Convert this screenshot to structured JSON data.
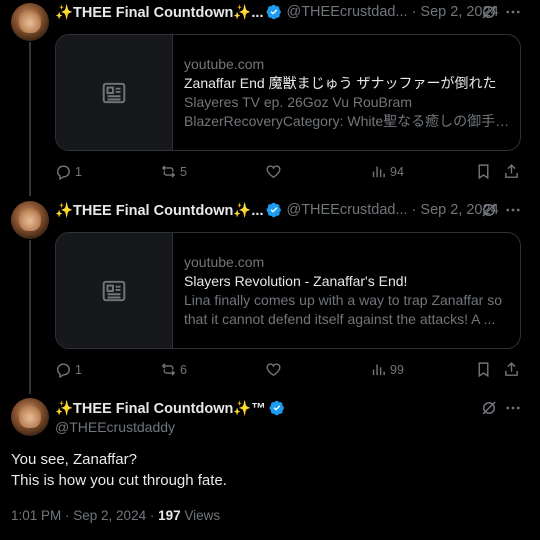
{
  "tweets": [
    {
      "name": "✨THEE Final Countdown✨...",
      "handle": "@THEEcrustdad...",
      "separator": "·",
      "date": "Sep 2, 2024",
      "card": {
        "domain": "youtube.com",
        "title": "Zanaffar End 魔獣まじゅう ザナッファーが倒れた",
        "description": "Slayeres TV ep. 26Goz Vu RouBram BlazerRecoveryCategory: White聖なる癒しの御手よ..."
      },
      "actions": {
        "replies": "1",
        "reposts": "5",
        "likes": "",
        "views": "94"
      }
    },
    {
      "name": "✨THEE Final Countdown✨...",
      "handle": "@THEEcrustdad...",
      "separator": "·",
      "date": "Sep 2, 2024",
      "card": {
        "domain": "youtube.com",
        "title": "Slayers Revolution - Zanaffar's End!",
        "description": "Lina finally comes up with a way to trap Zanaffar so that it cannot defend itself against the attacks! A ..."
      },
      "actions": {
        "replies": "1",
        "reposts": "6",
        "likes": "",
        "views": "99"
      }
    }
  ],
  "main": {
    "name": "✨THEE Final Countdown✨™",
    "handle": "@THEEcrustdaddy",
    "text_line1": "You see, Zanaffar?",
    "text_line2": "This is how you cut through fate.",
    "time": "1:01 PM · Sep 2, 2024 · ",
    "views_count": "197",
    "views_label": " Views"
  },
  "icons": {
    "verified": "verified-badge-icon",
    "grok": "grok-icon",
    "more": "more-icon",
    "reply": "reply-icon",
    "repost": "repost-icon",
    "like": "like-icon",
    "views": "views-icon",
    "bookmark": "bookmark-icon",
    "share": "share-icon",
    "card_placeholder": "article-icon"
  },
  "colors": {
    "background": "#000000",
    "text": "#e7e9ea",
    "muted": "#71767b",
    "border": "#2f3336",
    "verified": "#1d9bf0"
  }
}
